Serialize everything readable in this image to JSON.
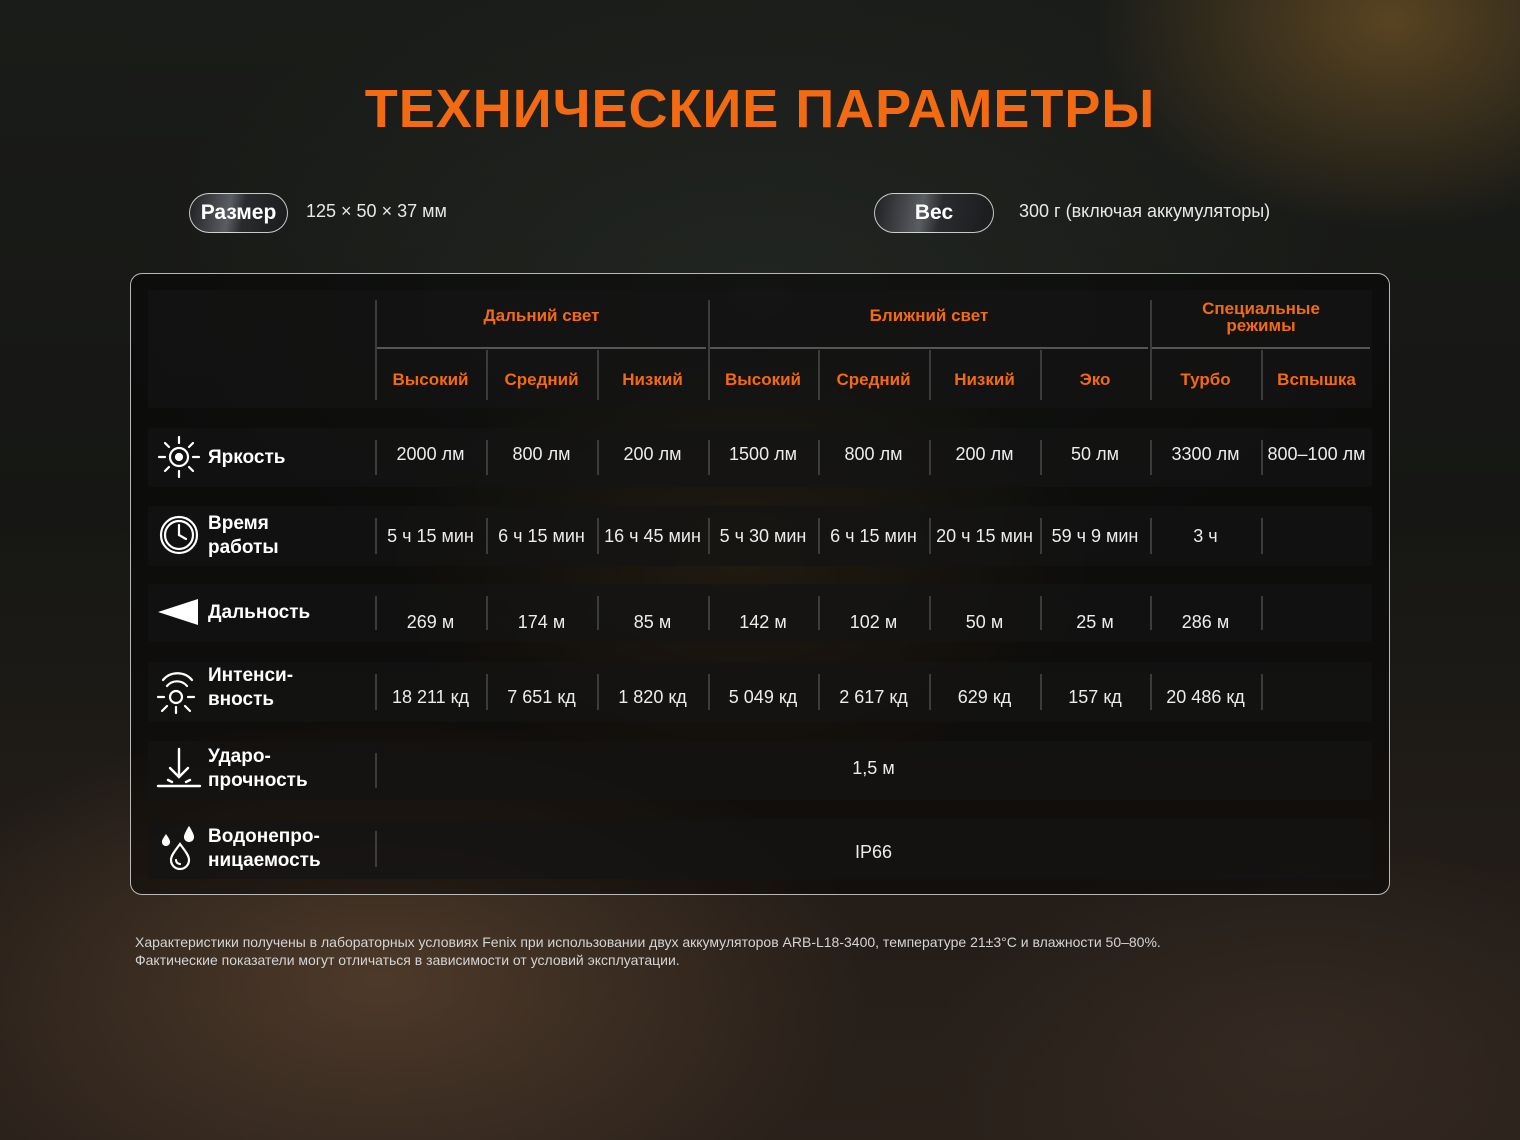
{
  "title": "ТЕХНИЧЕСКИЕ ПАРАМЕТРЫ",
  "size": {
    "label": "Размер",
    "value": "125 × 50 × 37 мм"
  },
  "weight": {
    "label": "Вес",
    "value": "300 г (включая аккумуляторы)"
  },
  "groups": [
    "Дальний свет",
    "Ближний свет",
    "Специальные\nрежимы"
  ],
  "modes": [
    "Высокий",
    "Средний",
    "Низкий",
    "Высокий",
    "Средний",
    "Низкий",
    "Эко",
    "Турбо",
    "Вспышка"
  ],
  "rows": [
    {
      "label": "Яркость",
      "icon": "brightness-sun-icon",
      "values": [
        "2000 лм",
        "800 лм",
        "200 лм",
        "1500 лм",
        "800 лм",
        "200 лм",
        "50 лм",
        "3300 лм",
        "800–100 лм"
      ]
    },
    {
      "label": "Время\nработы",
      "icon": "clock-icon",
      "values": [
        "5 ч 15 мин",
        "6 ч 15 мин",
        "16 ч 45 мин",
        "5 ч 30 мин",
        "6 ч 15 мин",
        "20 ч 15 мин",
        "59 ч 9 мин",
        "3 ч",
        ""
      ]
    },
    {
      "label": "Дальность",
      "icon": "beam-distance-icon",
      "values": [
        "269 м",
        "174 м",
        "85 м",
        "142 м",
        "102 м",
        "50 м",
        "25 м",
        "286 м",
        ""
      ]
    },
    {
      "label": "Интенси-\nвность",
      "icon": "intensity-icon",
      "values": [
        "18 211 кд",
        "7 651 кд",
        "1 820 кд",
        "5 049 кд",
        "2 617 кд",
        "629 кд",
        "157 кд",
        "20 486 кд",
        ""
      ]
    },
    {
      "label": "Ударо-\nпрочность",
      "icon": "impact-arrow-icon",
      "value": "1,5 м"
    },
    {
      "label": "Водонепро-\nницаемость",
      "icon": "water-drops-icon",
      "value": "IP66"
    }
  ],
  "footnote": "Характеристики получены в лабораторных условиях Fenix при использовании двух аккумуляторов ARB-L18-3400, температуре 21±3°C и влажности 50–80%.\nФактические показатели могут отличаться в зависимости от условий эксплуатации."
}
